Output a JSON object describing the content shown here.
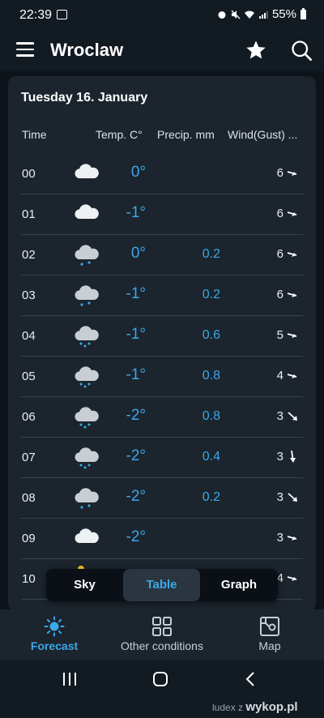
{
  "status_bar": {
    "time": "22:39",
    "battery": "55%"
  },
  "app_bar": {
    "title": "Wroclaw"
  },
  "card": {
    "date": "Tuesday 16. January",
    "headers": {
      "time": "Time",
      "temp": "Temp. C°",
      "precip": "Precip. mm",
      "wind": "Wind(Gust) ..."
    },
    "rows": [
      {
        "time": "00",
        "icon": "cloud-icon",
        "temp": "0°",
        "precip": "",
        "wind": "6",
        "dir": "wind-arrow-right-icon"
      },
      {
        "time": "01",
        "icon": "cloud-icon",
        "temp": "-1°",
        "precip": "",
        "wind": "6",
        "dir": "wind-arrow-right-icon"
      },
      {
        "time": "02",
        "icon": "cloud-snow-icon",
        "temp": "0°",
        "precip": "0.2",
        "wind": "6",
        "dir": "wind-arrow-right-icon"
      },
      {
        "time": "03",
        "icon": "cloud-snow-icon",
        "temp": "-1°",
        "precip": "0.2",
        "wind": "6",
        "dir": "wind-arrow-right-icon"
      },
      {
        "time": "04",
        "icon": "cloud-heavy-snow-icon",
        "temp": "-1°",
        "precip": "0.6",
        "wind": "5",
        "dir": "wind-arrow-right-icon"
      },
      {
        "time": "05",
        "icon": "cloud-heavy-snow-icon",
        "temp": "-1°",
        "precip": "0.8",
        "wind": "4",
        "dir": "wind-arrow-right-icon"
      },
      {
        "time": "06",
        "icon": "cloud-heavy-snow-icon",
        "temp": "-2°",
        "precip": "0.8",
        "wind": "3",
        "dir": "wind-arrow-down-right-icon"
      },
      {
        "time": "07",
        "icon": "cloud-heavy-snow-icon",
        "temp": "-2°",
        "precip": "0.4",
        "wind": "3",
        "dir": "wind-arrow-down-icon"
      },
      {
        "time": "08",
        "icon": "cloud-snow-icon",
        "temp": "-2°",
        "precip": "0.2",
        "wind": "3",
        "dir": "wind-arrow-down-right-icon"
      },
      {
        "time": "09",
        "icon": "cloud-icon",
        "temp": "-2°",
        "precip": "",
        "wind": "3",
        "dir": "wind-arrow-right-icon"
      },
      {
        "time": "10",
        "icon": "sun-cloud-icon",
        "temp": "",
        "precip": "",
        "wind": "4",
        "dir": "wind-arrow-right-icon"
      }
    ]
  },
  "segmented": {
    "sky": "Sky",
    "table": "Table",
    "graph": "Graph",
    "selected": "Table"
  },
  "bottom_nav": {
    "forecast": "Forecast",
    "other": "Other conditions",
    "map": "Map",
    "active": "Forecast"
  },
  "watermark": {
    "user": "ludex",
    "z": "z",
    "site": "wykop.pl"
  },
  "colors": {
    "accent": "#3aa9e8",
    "background": "#0e1319",
    "card": "#1c242d"
  }
}
